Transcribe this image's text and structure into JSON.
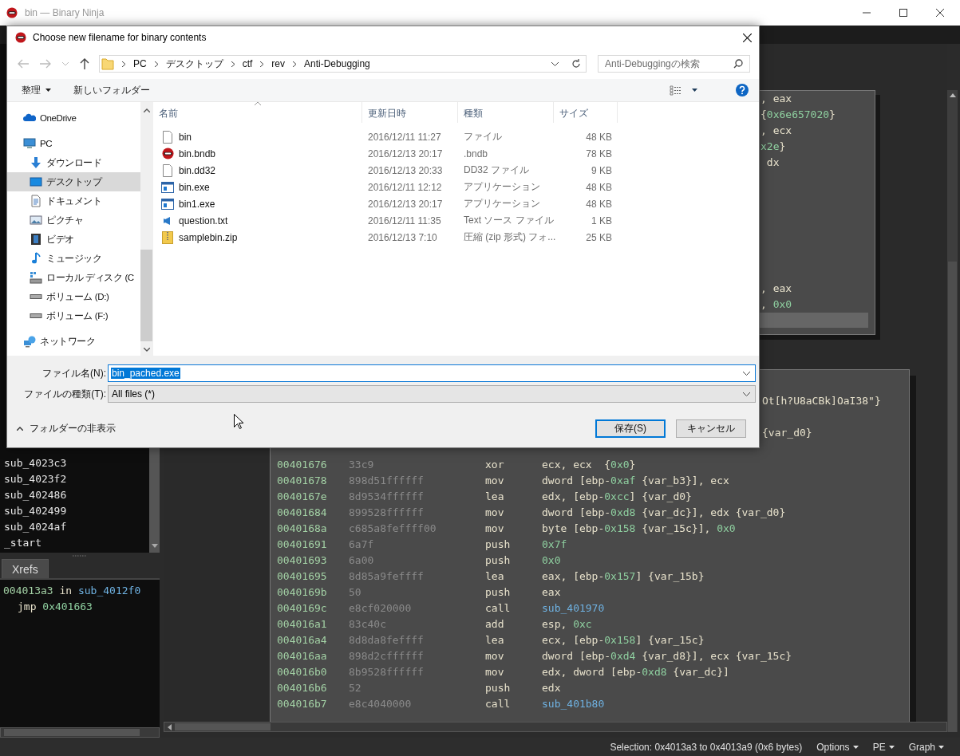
{
  "app": {
    "title": "bin — Binary Ninja"
  },
  "functions": [
    "sub_4023c3",
    "sub_4023f2",
    "sub_402486",
    "sub_402499",
    "sub_4024af",
    "_start"
  ],
  "xrefs": {
    "tab": "Xrefs",
    "address": "004013a3",
    "word": "in",
    "function": "sub_4012f0",
    "instruction": "jmp",
    "target": "0x401663"
  },
  "graph": {
    "upper_block": {
      "cursor_line": true,
      "lines_top": [
        [
          {
            "kind": "txt",
            "text": ", eax"
          }
        ],
        [
          {
            "kind": "txt",
            "text": "{"
          },
          {
            "kind": "num",
            "text": "0x6e657020"
          },
          {
            "kind": "txt",
            "text": "}"
          }
        ],
        [
          {
            "kind": "txt",
            "text": ", ecx"
          }
        ],
        [
          {
            "kind": "num",
            "text": "x2e"
          },
          {
            "kind": "txt",
            "text": "}"
          }
        ],
        [
          {
            "kind": "txt",
            "text": " dx"
          }
        ]
      ],
      "lines_bottom": [
        [
          {
            "kind": "txt",
            "text": ", eax"
          }
        ],
        [
          {
            "kind": "txt",
            "text": ", "
          },
          {
            "kind": "num",
            "text": "0x0"
          }
        ]
      ]
    },
    "lower_block": {
      "fragments": [
        [
          {
            "kind": "txt",
            "text": "Ot[h?U8aCBk]OaI38\"}"
          }
        ],
        [
          {
            "kind": "txt",
            "text": "{var_d0}"
          }
        ]
      ],
      "rows": [
        {
          "address": "00401676",
          "bytes": "33c9",
          "mnemonic": "xor",
          "operands": [
            {
              "kind": "txt",
              "text": "ecx, ecx  {"
            },
            {
              "kind": "num",
              "text": "0x0"
            },
            {
              "kind": "txt",
              "text": "}"
            }
          ]
        },
        {
          "address": "00401678",
          "bytes": "898d51ffffff",
          "mnemonic": "mov",
          "operands": [
            {
              "kind": "txt",
              "text": "dword [ebp-"
            },
            {
              "kind": "num",
              "text": "0xaf"
            },
            {
              "kind": "txt",
              "text": " {var_b3}], ecx"
            }
          ]
        },
        {
          "address": "0040167e",
          "bytes": "8d9534ffffff",
          "mnemonic": "lea",
          "operands": [
            {
              "kind": "txt",
              "text": "edx, [ebp-"
            },
            {
              "kind": "num",
              "text": "0xcc"
            },
            {
              "kind": "txt",
              "text": "] {var_d0}"
            }
          ]
        },
        {
          "address": "00401684",
          "bytes": "899528ffffff",
          "mnemonic": "mov",
          "operands": [
            {
              "kind": "txt",
              "text": "dword [ebp-"
            },
            {
              "kind": "num",
              "text": "0xd8"
            },
            {
              "kind": "txt",
              "text": " {var_dc}], edx {var_d0}"
            }
          ]
        },
        {
          "address": "0040168a",
          "bytes": "c685a8feffff00",
          "mnemonic": "mov",
          "operands": [
            {
              "kind": "txt",
              "text": "byte [ebp-"
            },
            {
              "kind": "num",
              "text": "0x158"
            },
            {
              "kind": "txt",
              "text": " {var_15c}], "
            },
            {
              "kind": "num",
              "text": "0x0"
            }
          ]
        },
        {
          "address": "00401691",
          "bytes": "6a7f",
          "mnemonic": "push",
          "operands": [
            {
              "kind": "num",
              "text": "0x7f"
            }
          ]
        },
        {
          "address": "00401693",
          "bytes": "6a00",
          "mnemonic": "push",
          "operands": [
            {
              "kind": "num",
              "text": "0x0"
            }
          ]
        },
        {
          "address": "00401695",
          "bytes": "8d85a9feffff",
          "mnemonic": "lea",
          "operands": [
            {
              "kind": "txt",
              "text": "eax, [ebp-"
            },
            {
              "kind": "num",
              "text": "0x157"
            },
            {
              "kind": "txt",
              "text": "] {var_15b}"
            }
          ]
        },
        {
          "address": "0040169b",
          "bytes": "50",
          "mnemonic": "push",
          "operands": [
            {
              "kind": "txt",
              "text": "eax"
            }
          ]
        },
        {
          "address": "0040169c",
          "bytes": "e8cf020000",
          "mnemonic": "call",
          "operands": [
            {
              "kind": "sym",
              "text": "sub_401970"
            }
          ]
        },
        {
          "address": "004016a1",
          "bytes": "83c40c",
          "mnemonic": "add",
          "operands": [
            {
              "kind": "txt",
              "text": "esp, "
            },
            {
              "kind": "num",
              "text": "0xc"
            }
          ]
        },
        {
          "address": "004016a4",
          "bytes": "8d8da8feffff",
          "mnemonic": "lea",
          "operands": [
            {
              "kind": "txt",
              "text": "ecx, [ebp-"
            },
            {
              "kind": "num",
              "text": "0x158"
            },
            {
              "kind": "txt",
              "text": "] {var_15c}"
            }
          ]
        },
        {
          "address": "004016aa",
          "bytes": "898d2cffffff",
          "mnemonic": "mov",
          "operands": [
            {
              "kind": "txt",
              "text": "dword [ebp-"
            },
            {
              "kind": "num",
              "text": "0xd4"
            },
            {
              "kind": "txt",
              "text": " {var_d8}], ecx {var_15c}"
            }
          ]
        },
        {
          "address": "004016b0",
          "bytes": "8b9528ffffff",
          "mnemonic": "mov",
          "operands": [
            {
              "kind": "txt",
              "text": "edx, dword [ebp-"
            },
            {
              "kind": "num",
              "text": "0xd8"
            },
            {
              "kind": "txt",
              "text": " {var_dc}]"
            }
          ]
        },
        {
          "address": "004016b6",
          "bytes": "52",
          "mnemonic": "push",
          "operands": [
            {
              "kind": "txt",
              "text": "edx"
            }
          ]
        },
        {
          "address": "004016b7",
          "bytes": "e8c4040000",
          "mnemonic": "call",
          "operands": [
            {
              "kind": "sym",
              "text": "sub_401b80"
            }
          ]
        }
      ]
    }
  },
  "status_bar": {
    "selection": "Selection: 0x4013a3 to 0x4013a9 (0x6 bytes)",
    "menus": [
      "Options",
      "PE",
      "Graph"
    ]
  },
  "dialog": {
    "title": "Choose new filename for binary contents",
    "crumbs": [
      "PC",
      "デスクトップ",
      "ctf",
      "rev",
      "Anti-Debugging"
    ],
    "search": {
      "placeholder": "Anti-Debuggingの検索"
    },
    "toolbar": {
      "organize": "整理",
      "new_folder": "新しいフォルダー"
    },
    "nav": [
      {
        "label": "OneDrive",
        "kind": "cloud",
        "selected": false
      },
      {
        "label": "PC",
        "kind": "pc",
        "selected": false,
        "children": [
          {
            "label": "ダウンロード",
            "kind": "download",
            "selected": false
          },
          {
            "label": "デスクトップ",
            "kind": "desktop",
            "selected": true
          },
          {
            "label": "ドキュメント",
            "kind": "documents",
            "selected": false
          },
          {
            "label": "ピクチャ",
            "kind": "pictures",
            "selected": false
          },
          {
            "label": "ビデオ",
            "kind": "videos",
            "selected": false
          },
          {
            "label": "ミュージック",
            "kind": "music",
            "selected": false
          },
          {
            "label": "ローカル ディスク (C",
            "kind": "disk",
            "selected": false
          },
          {
            "label": "ボリューム (D:)",
            "kind": "drive",
            "selected": false
          },
          {
            "label": "ボリューム (F:)",
            "kind": "drive",
            "selected": false
          }
        ]
      },
      {
        "label": "ネットワーク",
        "kind": "network",
        "selected": false
      }
    ],
    "columns": [
      {
        "label": "名前",
        "sorted": true
      },
      {
        "label": "更新日時",
        "sorted": false
      },
      {
        "label": "種類",
        "sorted": false
      },
      {
        "label": "サイズ",
        "sorted": false
      }
    ],
    "files": [
      {
        "name": "bin",
        "date": "2016/12/11 11:27",
        "type": "ファイル",
        "size": "48 KB",
        "kind": "blank"
      },
      {
        "name": "bin.bndb",
        "date": "2016/12/13 20:17",
        "type": ".bndb",
        "size": "78 KB",
        "kind": "bndb"
      },
      {
        "name": "bin.dd32",
        "date": "2016/12/13 20:33",
        "type": "DD32 ファイル",
        "size": "9 KB",
        "kind": "blank"
      },
      {
        "name": "bin.exe",
        "date": "2016/12/11 12:12",
        "type": "アプリケーション",
        "size": "48 KB",
        "kind": "exe"
      },
      {
        "name": "bin1.exe",
        "date": "2016/12/13 20:17",
        "type": "アプリケーション",
        "size": "48 KB",
        "kind": "exe"
      },
      {
        "name": "question.txt",
        "date": "2016/12/11 11:35",
        "type": "Text ソース ファイル",
        "size": "1 KB",
        "kind": "code"
      },
      {
        "name": "samplebin.zip",
        "date": "2016/12/13 7:10",
        "type": "圧縮 (zip 形式) フォ...",
        "size": "25 KB",
        "kind": "zip"
      }
    ],
    "filename": {
      "label": "ファイル名(N):",
      "value": "bin_pached.exe",
      "text_selected": true
    },
    "filetype": {
      "label": "ファイルの種類(T):",
      "value": "All files (*)"
    },
    "hide_folders": "フォルダーの非表示",
    "buttons": [
      {
        "label": "保存(S)",
        "default": true
      },
      {
        "label": "キャンセル",
        "default": false
      }
    ]
  }
}
